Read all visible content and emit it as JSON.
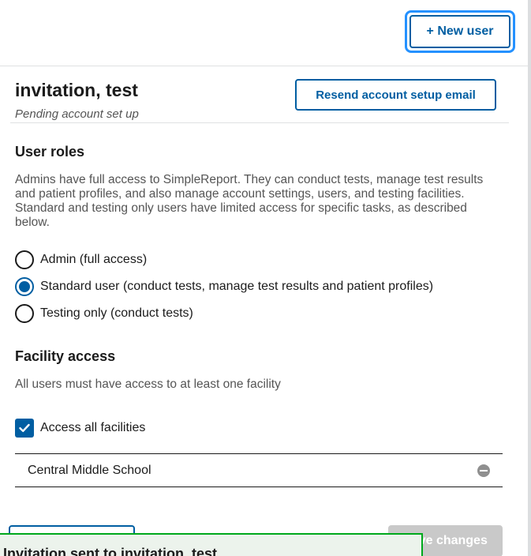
{
  "header": {
    "new_user_label": "+ New user"
  },
  "user": {
    "name": "invitation, test",
    "status": "Pending account set up",
    "resend_label": "Resend account setup email"
  },
  "roles": {
    "title": "User roles",
    "description": "Admins have full access to SimpleReport. They can conduct tests, manage test results and patient profiles, and also manage account settings, users, and testing facilities. Standard and testing only users have limited access for specific tasks, as described below.",
    "options": [
      {
        "label": "Admin (full access)",
        "checked": false
      },
      {
        "label": "Standard user (conduct tests, manage test results and patient profiles)",
        "checked": true
      },
      {
        "label": "Testing only (conduct tests)",
        "checked": false
      }
    ]
  },
  "facility": {
    "title": "Facility access",
    "description": "All users must have access to at least one facility",
    "access_all_label": "Access all facilities",
    "access_all_checked": true,
    "facilities": [
      {
        "name": "Central Middle School"
      }
    ]
  },
  "footer": {
    "save_label": "Save changes"
  },
  "toast": {
    "message": "Invitation sent to invitation, test"
  },
  "colors": {
    "primary": "#005ea2",
    "focus": "#2491ff",
    "success_border": "#00a91c",
    "success_bg": "#ecf3ec",
    "disabled": "#c9c9c9"
  }
}
